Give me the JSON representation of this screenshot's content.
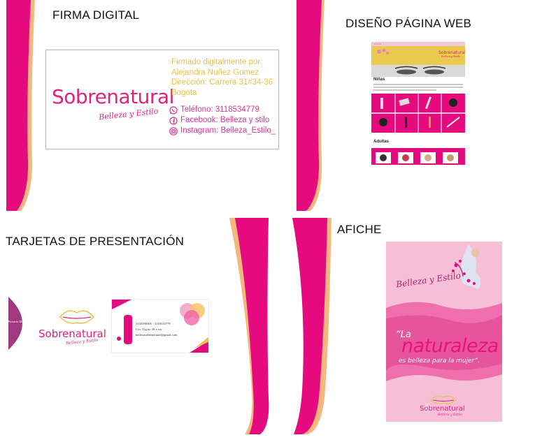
{
  "sections": {
    "firma": "FIRMA DIGITAL",
    "web": "DISEÑO PÁGINA WEB",
    "tarjetas": "TARJETAS DE PRESENTACIÓN",
    "afiche": "AFICHE"
  },
  "brand": {
    "name": "Sobrenatural",
    "tagline": "Belleza y Estilo"
  },
  "signature": {
    "lines": [
      "Firmado digitalmente por:",
      "Alejandra Nuñez Gomez",
      "Dirección: Carrera 31#34-36",
      "Bogota"
    ],
    "contacts": [
      {
        "icon": "whatsapp-icon",
        "text": "Teléfono: 3118534779"
      },
      {
        "icon": "facebook-icon",
        "text": "Facebook: Belleza y stilo"
      },
      {
        "icon": "instagram-icon",
        "text": "Instagram: Belleza_Estilo_"
      }
    ]
  },
  "web": {
    "section_ninas": "Niñas",
    "section_adultas": "Adultas"
  },
  "card": {
    "name": "Rosario Márquez",
    "phone": "3144090305 · 3118534779",
    "address": "Cra. 31g no 38 a sur",
    "email": "bellezasobrenatural@gmail.com"
  },
  "poster": {
    "script": "Belleza y Estilo",
    "quote_open": "“La",
    "quote_main": "naturaleza",
    "quote_end": "es belleza para la mujer”."
  },
  "colors": {
    "magenta": "#e50b7e",
    "peach": "#f6b77e",
    "gold": "#e8c24b"
  }
}
